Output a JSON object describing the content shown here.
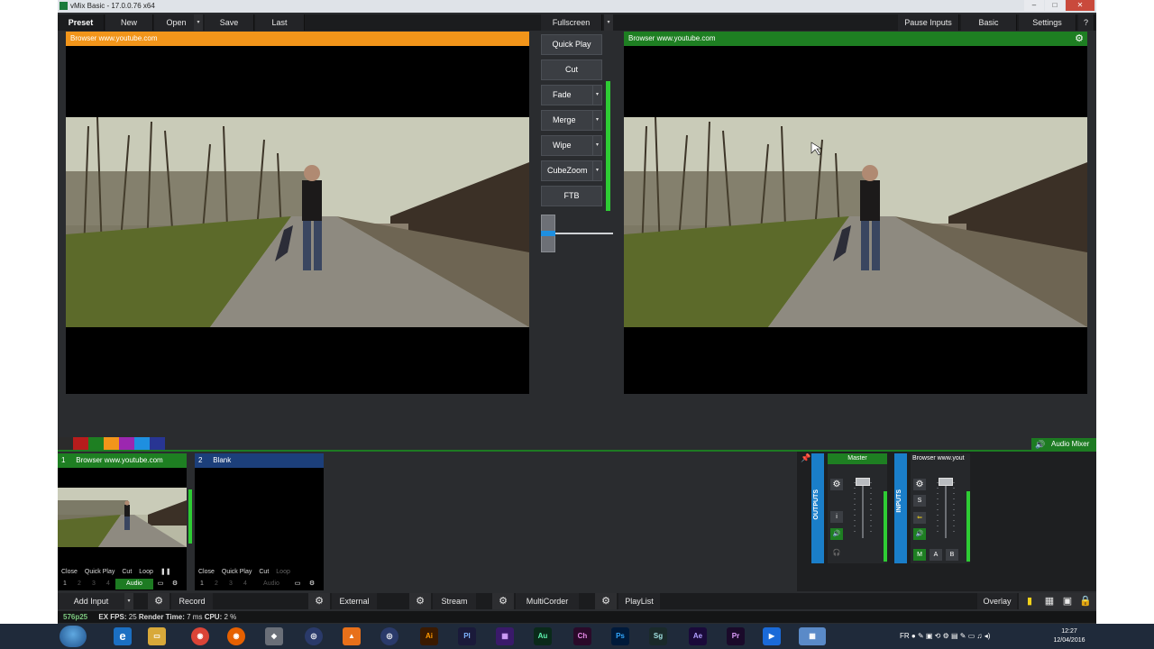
{
  "window": {
    "title": "vMix Basic - 17.0.0.76 x64",
    "min": "–",
    "max": "□",
    "close": "✕"
  },
  "toolbar": {
    "preset": "Preset",
    "new": "New",
    "open": "Open",
    "save": "Save",
    "last": "Last",
    "fullscreen": "Fullscreen",
    "pause_inputs": "Pause Inputs",
    "basic": "Basic",
    "settings": "Settings",
    "help": "?"
  },
  "preview": {
    "title": "Browser www.youtube.com"
  },
  "output": {
    "title": "Browser www.youtube.com"
  },
  "transitions": {
    "quick_play": "Quick Play",
    "cut": "Cut",
    "fade": "Fade",
    "merge": "Merge",
    "wipe": "Wipe",
    "cubezoom": "CubeZoom",
    "ftb": "FTB"
  },
  "swatch_colors": [
    "#2b2b2b",
    "#b71c1c",
    "#1e7f22",
    "#f2951a",
    "#9c27b0",
    "#1e8fe0",
    "#283593"
  ],
  "audio_mixer_label": "Audio Mixer",
  "inputs": [
    {
      "number": "1",
      "name": "Browser www.youtube.com",
      "head_color": "#1e7f22",
      "controls": [
        "Close",
        "Quick Play",
        "Cut",
        "Loop"
      ],
      "audio": "Audio"
    },
    {
      "number": "2",
      "name": "Blank",
      "head_color": "#1c3f7a",
      "controls": [
        "Close",
        "Quick Play",
        "Cut",
        "Loop"
      ],
      "audio": "Audio"
    }
  ],
  "input_row_numbers": [
    "1",
    "2",
    "3",
    "4"
  ],
  "mixer": {
    "outputs_label": "OUTPUTS",
    "inputs_label": "INPUTS",
    "master": "Master",
    "input_strip": "Browser www.yout",
    "solo": "S",
    "m": "M",
    "a": "A",
    "b": "B",
    "info": "i"
  },
  "bottom": {
    "add_input": "Add Input",
    "record": "Record",
    "external": "External",
    "stream": "Stream",
    "multicorder": "MultiCorder",
    "playlist": "PlayList",
    "overlay": "Overlay"
  },
  "status": {
    "resolution": "576p25",
    "ex": "EX",
    "fps_label": "FPS:",
    "fps": "25",
    "render_label": "Render Time:",
    "render": "7 ms",
    "cpu_label": "CPU:",
    "cpu": "2 %"
  },
  "taskbar": {
    "apps": [
      "Ai",
      "Pl",
      "Au",
      "Ch",
      "Ps",
      "Sg",
      "Ae",
      "Pr"
    ],
    "lang": "FR",
    "time": "12:27",
    "date": "12/04/2016"
  }
}
